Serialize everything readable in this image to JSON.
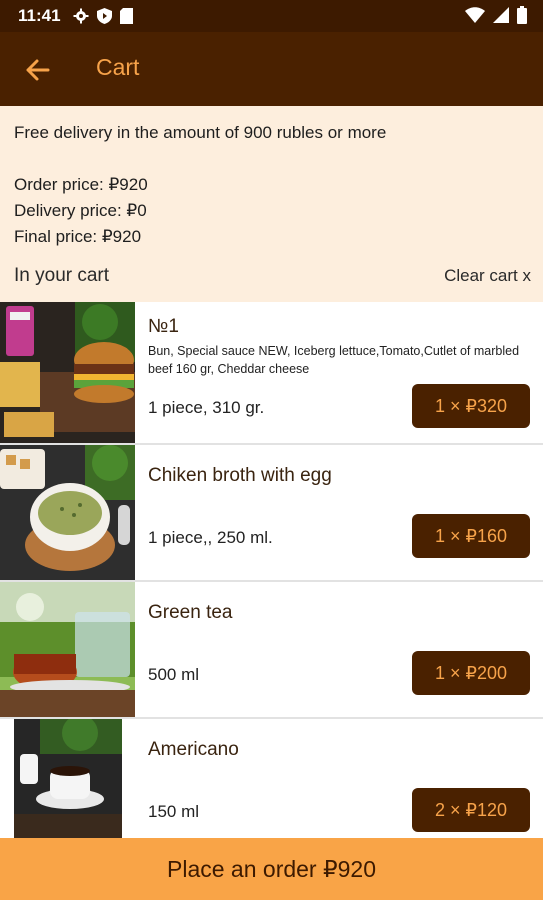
{
  "status_bar": {
    "time": "11:41",
    "left_icons": [
      "gear-icon",
      "shield-icon",
      "sim-card-icon"
    ],
    "right_icons": [
      "wifi-icon",
      "signal-icon",
      "battery-icon"
    ]
  },
  "app_bar": {
    "back_icon": "arrow-left-icon",
    "title": "Cart",
    "accent_color": "#f7a34a",
    "background": "#4a2100"
  },
  "summary": {
    "free_delivery_note": "Free delivery in the amount of 900 rubles or more",
    "order_price": "Order price: ₽920",
    "delivery_price": "Delivery price: ₽0",
    "final_price": "Final price: ₽920",
    "in_your_cart": "In your cart",
    "clear_cart": "Clear cart x"
  },
  "cart_items": [
    {
      "name": "№1",
      "description": "Bun, Special sauce NEW, Iceberg lettuce,Tomato,Cutlet of marbled beef 160 gr, Cheddar cheese",
      "quantity": "1 piece, 310 gr.",
      "price_button": "1 × ₽320"
    },
    {
      "name": "Chiken broth with egg",
      "quantity": "1 piece,, 250 ml.",
      "price_button": "1 × ₽160"
    },
    {
      "name": "Green tea",
      "quantity": "500 ml",
      "price_button": "1 × ₽200"
    },
    {
      "name": "Americano",
      "quantity": "150 ml",
      "price_button": "2 × ₽120"
    }
  ],
  "order_button": {
    "label": "Place an order ₽920",
    "background": "#f9a447"
  }
}
